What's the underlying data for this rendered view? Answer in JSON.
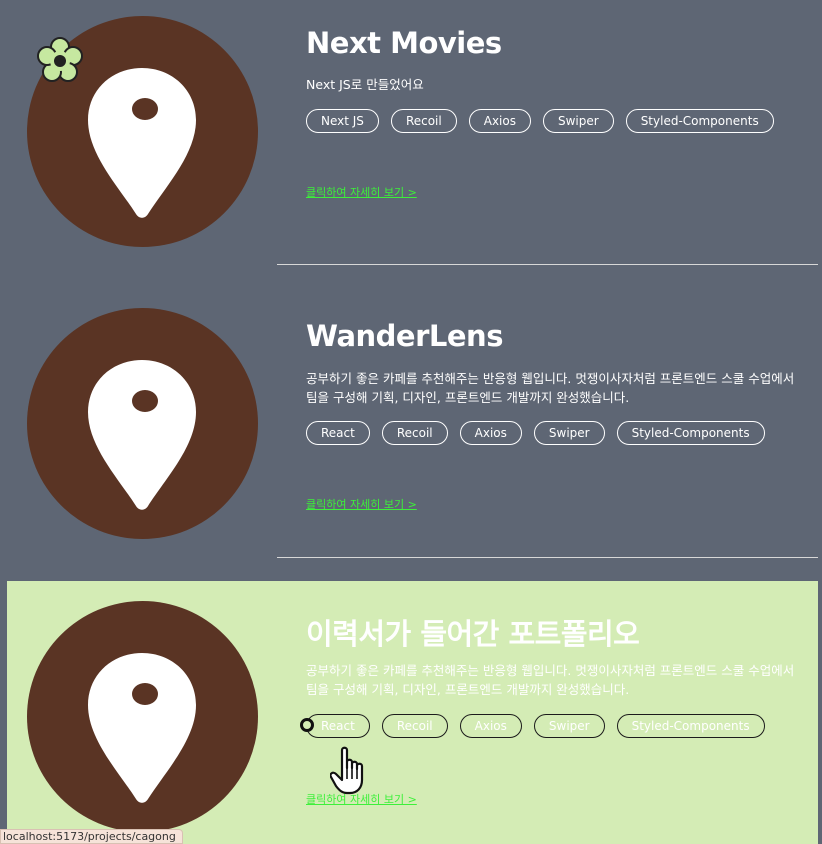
{
  "projects": [
    {
      "title": "Next Movies",
      "description": "Next JS로 만들었어요",
      "tags": [
        "Next JS",
        "Recoil",
        "Axios",
        "Swiper",
        "Styled-Components"
      ],
      "link_text": "클릭하여 자세히 보기 >"
    },
    {
      "title": "WanderLens",
      "description": "공부하기 좋은 카페를 추천해주는 반응형 웹입니다. 멋쟁이사자처럼 프론트엔드 스쿨 수업에서 팀을 구성해 기획, 디자인, 프론트엔드 개발까지 완성했습니다.",
      "tags": [
        "React",
        "Recoil",
        "Axios",
        "Swiper",
        "Styled-Components"
      ],
      "link_text": "클릭하여 자세히 보기 >"
    },
    {
      "title": "이력서가 들어간 포트폴리오",
      "description": "공부하기 좋은 카페를 추천해주는 반응형 웹입니다. 멋쟁이사자처럼 프론트엔드 스쿨 수업에서 팀을 구성해 기획, 디자인, 프론트엔드 개발까지 완성했습니다.",
      "tags": [
        "React",
        "Recoil",
        "Axios",
        "Swiper",
        "Styled-Components"
      ],
      "link_text": "클릭하여 자세히 보기 >"
    }
  ],
  "status_url": "localhost:5173/projects/cagong",
  "icons": {
    "thumbnail": "map-pin-icon",
    "decoration": "flower-icon",
    "cursor": "hand-pointer-icon"
  },
  "colors": {
    "page_bg": "#5e6674",
    "hover_bg": "#d4ecb5",
    "thumb_bg": "#5a3424",
    "link": "#3df03a"
  }
}
